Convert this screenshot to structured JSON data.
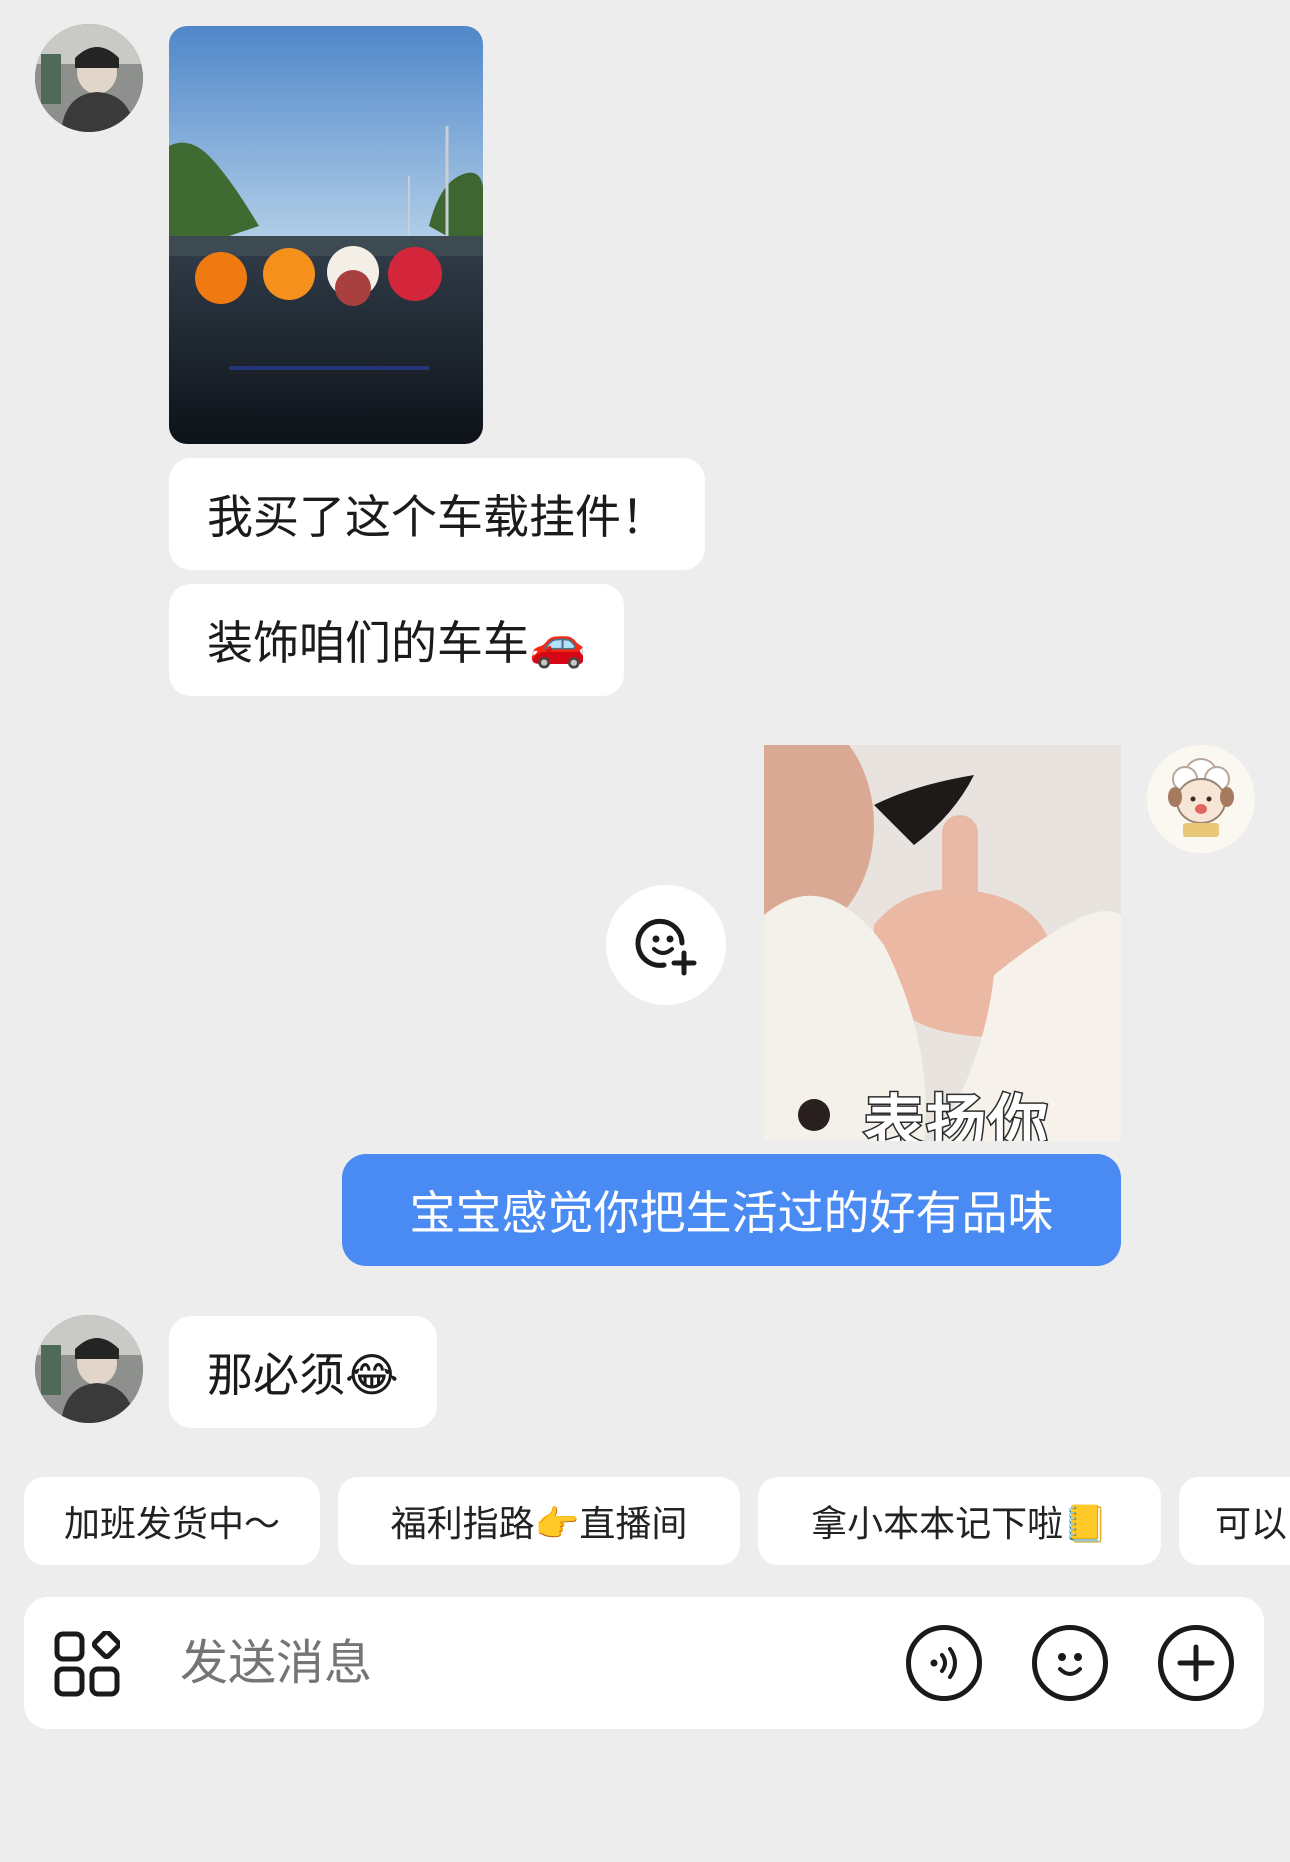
{
  "conversation": {
    "messages": [
      {
        "sender": "other",
        "type": "image",
        "image_desc": "fruit-car-ornaments-photo"
      },
      {
        "sender": "other",
        "type": "text",
        "text": "我买了这个车载挂件！"
      },
      {
        "sender": "other",
        "type": "text",
        "text": "装饰咱们的车车🚗"
      },
      {
        "sender": "me",
        "type": "sticker",
        "caption": "表扬你"
      },
      {
        "sender": "me",
        "type": "text",
        "text": "宝宝感觉你把生活过的好有品味"
      },
      {
        "sender": "other",
        "type": "text",
        "text": "那必须😂"
      }
    ]
  },
  "quick_replies": [
    "加班发货中～",
    "福利指路👉直播间",
    "拿小本本记下啦📒",
    "可以"
  ],
  "input": {
    "placeholder": "发送消息"
  },
  "colors": {
    "background": "#ededed",
    "my_bubble": "#4a8bf3",
    "other_bubble": "#ffffff"
  },
  "icons": {
    "apps": "apps-grid-icon",
    "voice": "voice-icon",
    "emoji": "emoji-icon",
    "plus": "plus-icon",
    "add_sticker": "add-sticker-icon"
  }
}
